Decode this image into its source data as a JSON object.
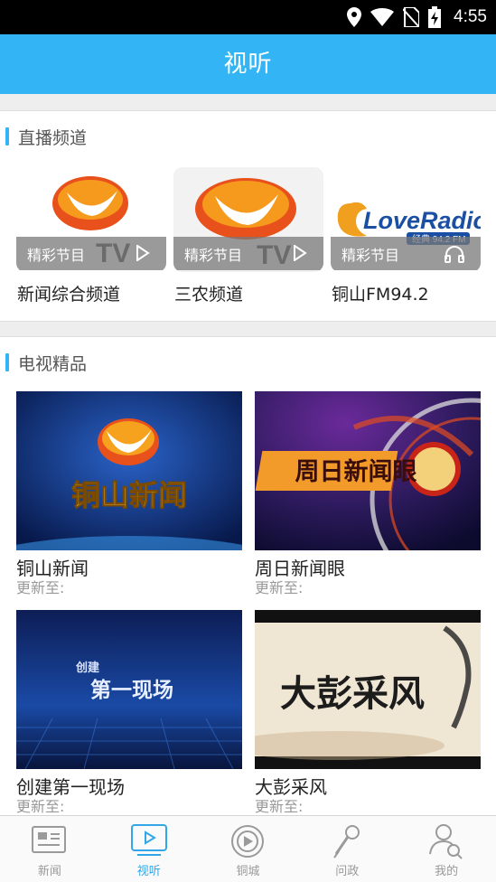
{
  "status": {
    "time": "4:55"
  },
  "header": {
    "title": "视听"
  },
  "live_section": {
    "title": "直播频道",
    "channels": [
      {
        "name": "新闻综合频道",
        "overlay": "精彩节目",
        "action_icon": "play-icon"
      },
      {
        "name": "三农频道",
        "overlay": "精彩节目",
        "action_icon": "play-icon"
      },
      {
        "name": "铜山FM94.2",
        "overlay": "精彩节目",
        "action_icon": "headphones-icon"
      }
    ],
    "logo_text": "TV",
    "radio_logo": {
      "main": "LoveRadio",
      "sub": "经典 94.2 FM"
    }
  },
  "vod_section": {
    "title": "电视精品",
    "items": [
      {
        "title": "铜山新闻",
        "sub": "更新至:",
        "poster_text": "铜山新闻"
      },
      {
        "title": "周日新闻眼",
        "sub": "更新至:",
        "poster_text": "周日新闻眼"
      },
      {
        "title": "创建第一现场",
        "sub": "更新至:",
        "poster_small": "创建",
        "poster_text": "第一现场"
      },
      {
        "title": "大彭采风",
        "sub": "更新至:",
        "poster_text": "大彭采风"
      }
    ]
  },
  "tabs": [
    {
      "label": "新闻",
      "icon": "newspaper-icon"
    },
    {
      "label": "视听",
      "icon": "video-play-icon"
    },
    {
      "label": "铜城",
      "icon": "city-compass-icon"
    },
    {
      "label": "问政",
      "icon": "microphone-icon"
    },
    {
      "label": "我的",
      "icon": "user-search-icon"
    }
  ],
  "colors": {
    "accent": "#33b5f5",
    "tab_active": "#33a6e8"
  }
}
